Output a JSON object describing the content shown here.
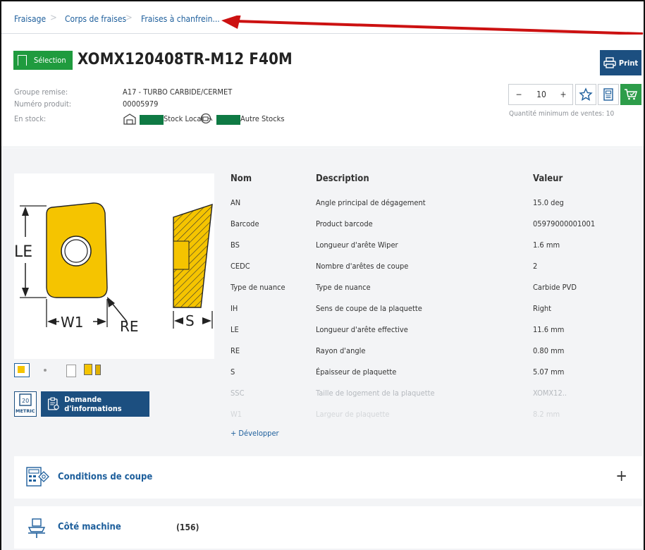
{
  "breadcrumb": [
    "Fraisage",
    "Corps de fraises",
    "Fraises à chanfrein..."
  ],
  "product": {
    "selection_label": "Sélection",
    "title": "XOMX120408TR-M12 F40M",
    "print_label": "Print",
    "group_label": "Groupe remise:",
    "group_value": "A17 - TURBO CARBIDE/CERMET",
    "number_label": "Numéro produit:",
    "number_value": "00005979",
    "stock_label": "En stock:",
    "stock_local": "Stock Local",
    "stock_other": "Autre Stocks"
  },
  "quantity": {
    "minus": "−",
    "value": "10",
    "plus": "+",
    "min_note": "Quantité minimum de ventes: 10"
  },
  "diagram": {
    "le": "LE",
    "w1": "W1",
    "re": "RE",
    "s": "S"
  },
  "metric_label": "METRIC",
  "info_button": "Demande d'informations",
  "table": {
    "headers": [
      "Nom",
      "Description",
      "Valeur"
    ],
    "rows": [
      [
        "AN",
        "Angle principal de dégagement",
        "15.0 deg"
      ],
      [
        "Barcode",
        "Product barcode",
        "05979000001001"
      ],
      [
        "BS",
        "Longueur d'arête Wiper",
        "1.6 mm"
      ],
      [
        "CEDC",
        "Nombre d'arêtes de coupe",
        "2"
      ],
      [
        "Type de nuance",
        "Type de nuance",
        "Carbide PVD"
      ],
      [
        "IH",
        "Sens de coupe de la plaquette",
        "Right"
      ],
      [
        "LE",
        "Longueur d'arête effective",
        "11.6 mm"
      ],
      [
        "RE",
        "Rayon d'angle",
        "0.80 mm"
      ],
      [
        "S",
        "Épaisseur de plaquette",
        "5.07 mm"
      ],
      [
        "SSC",
        "Taille de logement de la plaquette",
        "XOMX12.."
      ],
      [
        "W1",
        "Largeur de plaquette",
        "8.2 mm"
      ]
    ],
    "expand_label": "+ Développer"
  },
  "panels": {
    "cutting": {
      "title": "Conditions de coupe",
      "toggle": "+"
    },
    "machine": {
      "title": "Côté machine",
      "count": "(156)"
    }
  },
  "colors": {
    "accent_blue": "#1c4f80",
    "green": "#1f9b3e",
    "annotation_red": "#cc1111",
    "stock_green": "#0f7a44"
  }
}
